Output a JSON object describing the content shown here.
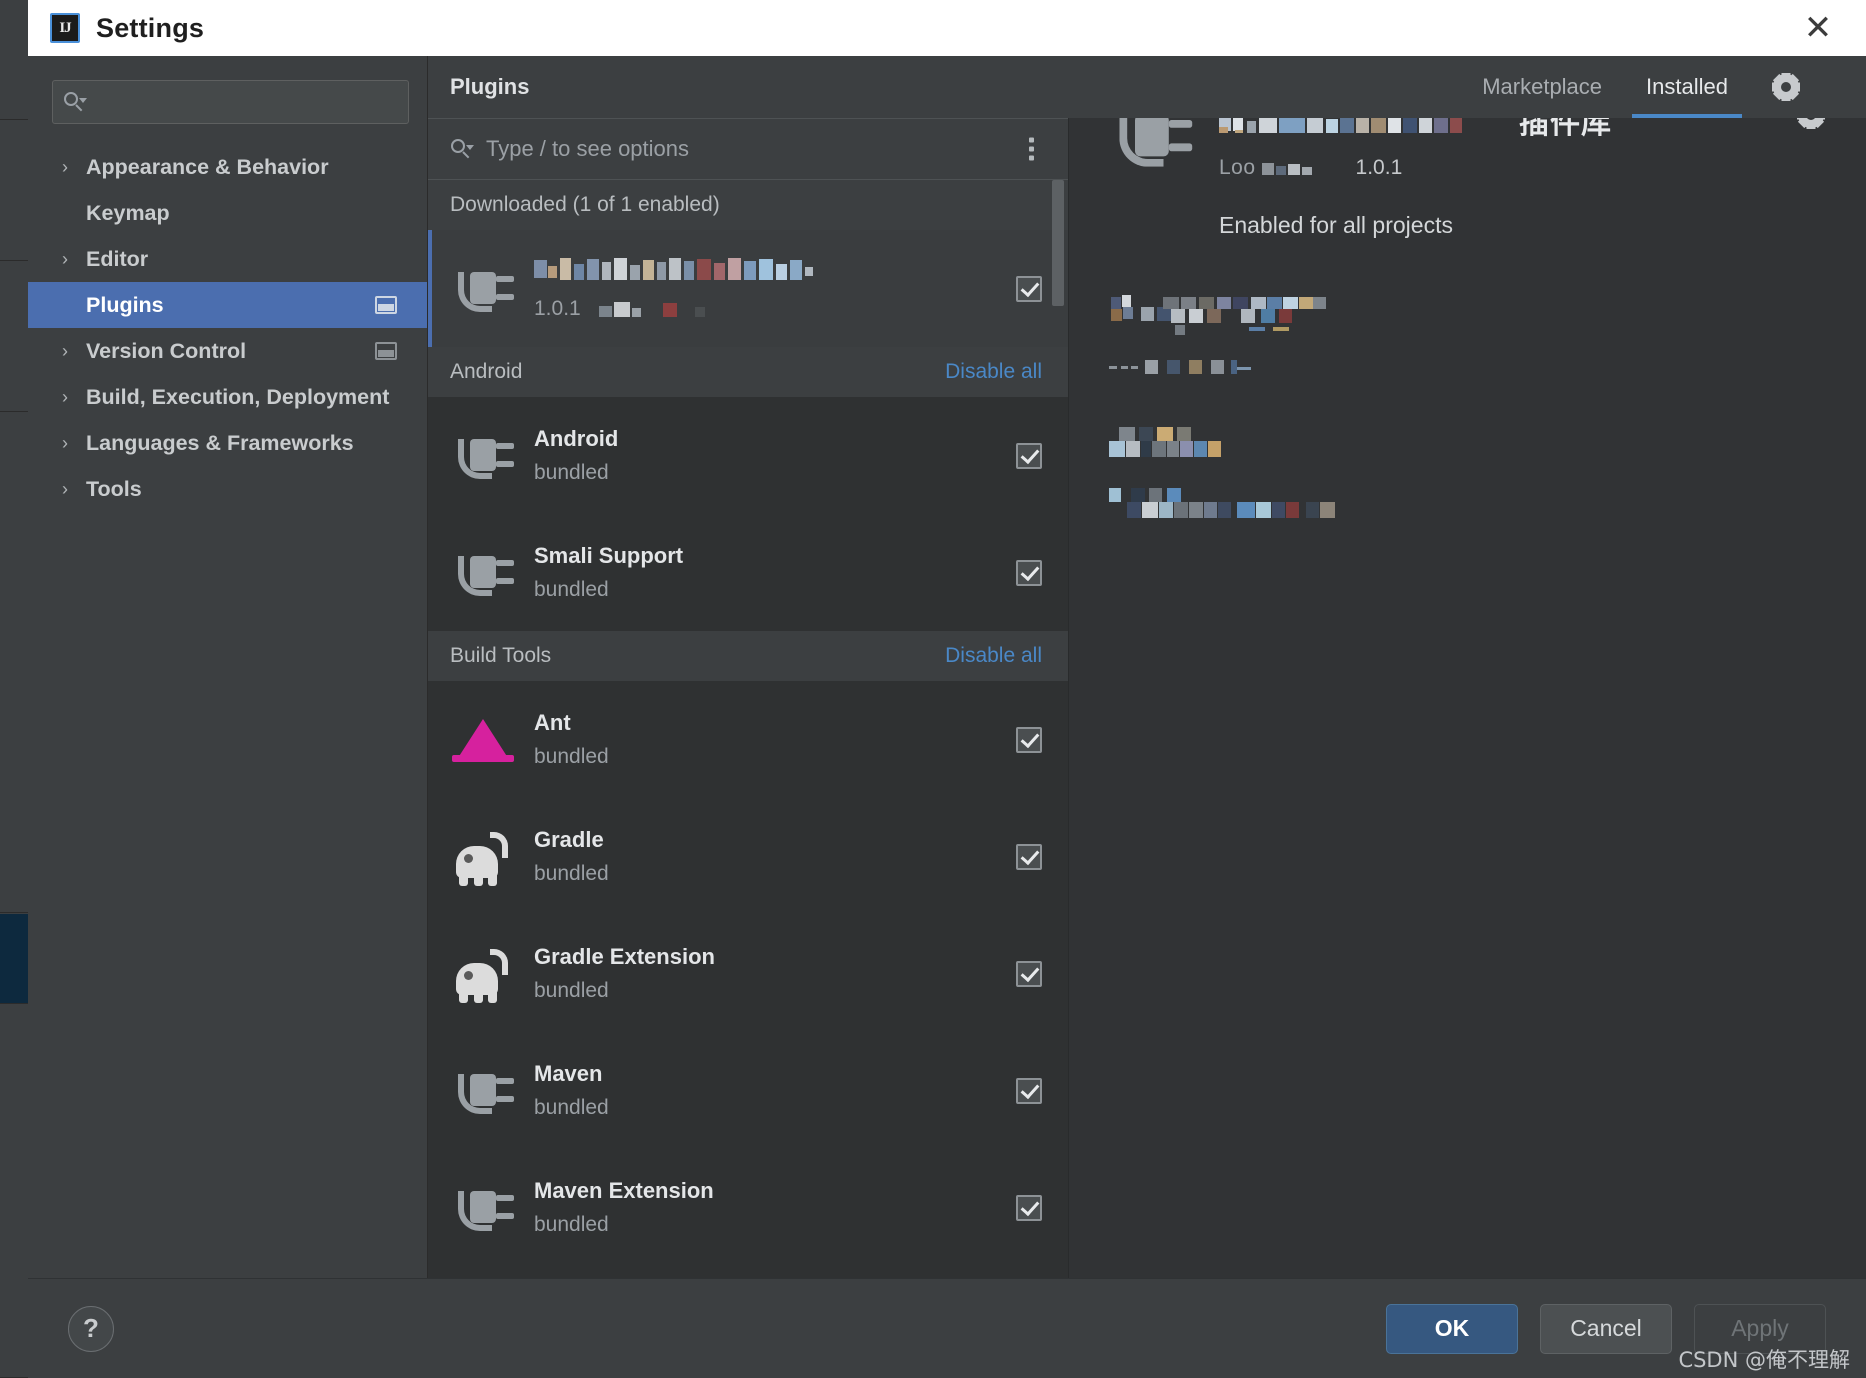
{
  "window": {
    "title": "Settings",
    "app_icon": "IJ",
    "close_icon": "✕"
  },
  "sidebar": {
    "search_placeholder": "",
    "items": [
      {
        "label": "Appearance & Behavior",
        "expandable": true,
        "selected": false,
        "has_panel_icon": false
      },
      {
        "label": "Keymap",
        "expandable": false,
        "selected": false,
        "has_panel_icon": false
      },
      {
        "label": "Editor",
        "expandable": true,
        "selected": false,
        "has_panel_icon": false
      },
      {
        "label": "Plugins",
        "expandable": false,
        "selected": true,
        "has_panel_icon": true
      },
      {
        "label": "Version Control",
        "expandable": true,
        "selected": false,
        "has_panel_icon": true
      },
      {
        "label": "Build, Execution, Deployment",
        "expandable": true,
        "selected": false,
        "has_panel_icon": false
      },
      {
        "label": "Languages & Frameworks",
        "expandable": true,
        "selected": false,
        "has_panel_icon": false
      },
      {
        "label": "Tools",
        "expandable": true,
        "selected": false,
        "has_panel_icon": false
      }
    ]
  },
  "plugins_panel": {
    "title": "Plugins",
    "tabs": [
      {
        "label": "Marketplace",
        "active": false
      },
      {
        "label": "Installed",
        "active": true
      }
    ],
    "gear_icon": "gear-icon",
    "search_placeholder": "Type / to see options",
    "kebab_icon": "more-options-icon",
    "sections": [
      {
        "title": "Downloaded (1 of 1 enabled)",
        "disable_all": null,
        "plugins": [
          {
            "name": "",
            "name_redacted": true,
            "sub": "1.0.1",
            "sub_redacted": true,
            "icon": "plug-icon",
            "checked": true,
            "selected": true
          }
        ]
      },
      {
        "title": "Android",
        "disable_all": "Disable all",
        "plugins": [
          {
            "name": "Android",
            "name_redacted": false,
            "sub": "bundled",
            "sub_redacted": false,
            "icon": "plug-icon",
            "checked": true,
            "selected": false
          },
          {
            "name": "Smali Support",
            "name_redacted": false,
            "sub": "bundled",
            "sub_redacted": false,
            "icon": "plug-icon",
            "checked": true,
            "selected": false
          }
        ]
      },
      {
        "title": "Build Tools",
        "disable_all": "Disable all",
        "plugins": [
          {
            "name": "Ant",
            "name_redacted": false,
            "sub": "bundled",
            "sub_redacted": false,
            "icon": "ant-icon",
            "checked": true,
            "selected": false
          },
          {
            "name": "Gradle",
            "name_redacted": false,
            "sub": "bundled",
            "sub_redacted": false,
            "icon": "gradle-icon",
            "checked": true,
            "selected": false
          },
          {
            "name": "Gradle Extension",
            "name_redacted": false,
            "sub": "bundled",
            "sub_redacted": false,
            "icon": "gradle-icon",
            "checked": true,
            "selected": false
          },
          {
            "name": "Maven",
            "name_redacted": false,
            "sub": "bundled",
            "sub_redacted": false,
            "icon": "plug-icon",
            "checked": true,
            "selected": false
          },
          {
            "name": "Maven Extension",
            "name_redacted": false,
            "sub": "bundled",
            "sub_redacted": false,
            "icon": "plug-icon",
            "checked": true,
            "selected": false
          }
        ]
      }
    ]
  },
  "detail": {
    "icon": "plug-icon",
    "gear_icon": "gear-icon",
    "title_redacted": true,
    "title_visible_suffix": "插件库",
    "vendor_prefix": "Loo",
    "vendor_redacted": true,
    "version": "1.0.1",
    "enabled_text": "Enabled for all projects",
    "description_redacted": true
  },
  "footer": {
    "help_label": "?",
    "buttons": [
      {
        "label": "OK",
        "style": "primary"
      },
      {
        "label": "Cancel",
        "style": "normal"
      },
      {
        "label": "Apply",
        "style": "disabled"
      }
    ]
  },
  "watermark": "CSDN @俺不理解",
  "colors": {
    "accent_blue": "#4b6eaf",
    "tab_underline": "#4a88c7",
    "link_blue": "#4a88c7",
    "titlebar_bg": "#ffffff",
    "dialog_bg": "#3c3f41",
    "list_bg": "#2f3132",
    "detail_bg": "#313335",
    "ant_magenta": "#d6219e",
    "gradle_white": "#dcdcdc"
  }
}
